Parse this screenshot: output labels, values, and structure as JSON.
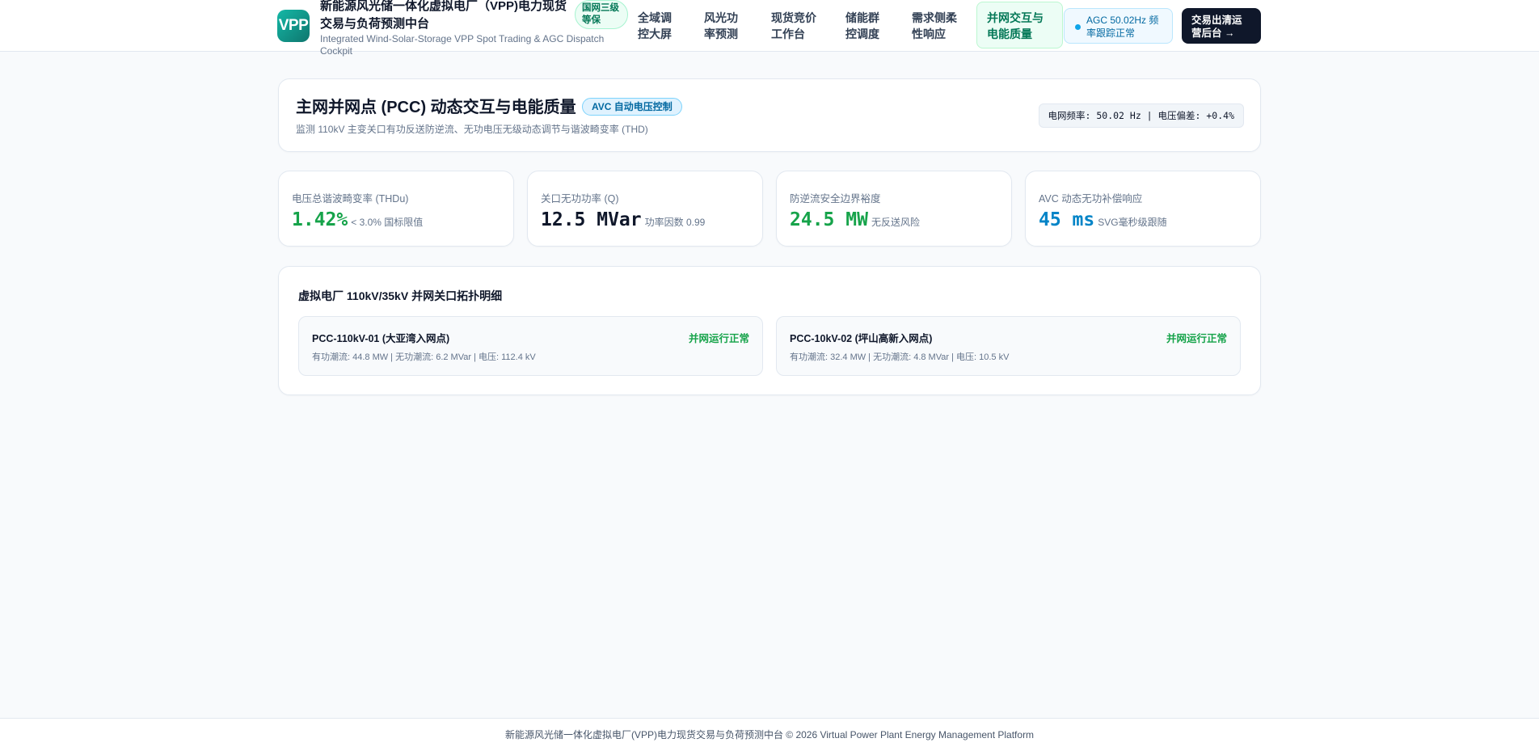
{
  "header": {
    "logo_text": "VPP",
    "title": "新能源风光储一体化虚拟电厂（VPP)电力现货交易与负荷预测中台",
    "subtitle": "Integrated Wind-Solar-Storage VPP Spot Trading & AGC Dispatch Cockpit",
    "level_badge": "国网三级等保",
    "nav": [
      {
        "label": "全域调控大屏",
        "active": false
      },
      {
        "label": "风光功率预测",
        "active": false
      },
      {
        "label": "现货竞价工作台",
        "active": false
      },
      {
        "label": "储能群控调度",
        "active": false
      },
      {
        "label": "需求侧柔性响应",
        "active": false
      },
      {
        "label": "并网交互与电能质量",
        "active": true
      }
    ],
    "agc_status": "AGC 50.02Hz 频率跟踪正常",
    "back_button": "交易出清运营后台 →"
  },
  "hero": {
    "title": "主网并网点 (PCC) 动态交互与电能质量",
    "badge": "AVC 自动电压控制",
    "subtitle": "监测 110kV 主变关口有功反送防逆流、无功电压无级动态调节与谐波畸变率 (THD)",
    "freq_text": "电网频率: 50.02 Hz | 电压偏差: +0.4%"
  },
  "kpis": [
    {
      "label": "电压总谐波畸变率 (THDu)",
      "value": "1.42%",
      "note": "< 3.0% 国标限值",
      "color": "#16a34a"
    },
    {
      "label": "关口无功功率 (Q)",
      "value": "12.5 MVar",
      "note": "功率因数 0.99",
      "color": "#0f172a"
    },
    {
      "label": "防逆流安全边界裕度",
      "value": "24.5 MW",
      "note": "无反送风险",
      "color": "#16a34a"
    },
    {
      "label": "AVC 动态无功补偿响应",
      "value": "45 ms",
      "note": "SVG毫秒级跟随",
      "color": "#0284c7"
    }
  ],
  "topology": {
    "title": "虚拟电厂 110kV/35kV 并网关口拓扑明细",
    "points": [
      {
        "name": "PCC-110kV-01 (大亚湾入网点)",
        "status": "并网运行正常",
        "detail": "有功潮流: 44.8 MW | 无功潮流: 6.2 MVar | 电压: 112.4 kV"
      },
      {
        "name": "PCC-10kV-02 (坪山高新入网点)",
        "status": "并网运行正常",
        "detail": "有功潮流: 32.4 MW | 无功潮流: 4.8 MVar | 电压: 10.5 kV"
      }
    ]
  },
  "footer": {
    "text": "新能源风光储一体化虚拟电厂(VPP)电力现货交易与负荷预测中台 © 2026 Virtual Power Plant Energy Management Platform"
  }
}
